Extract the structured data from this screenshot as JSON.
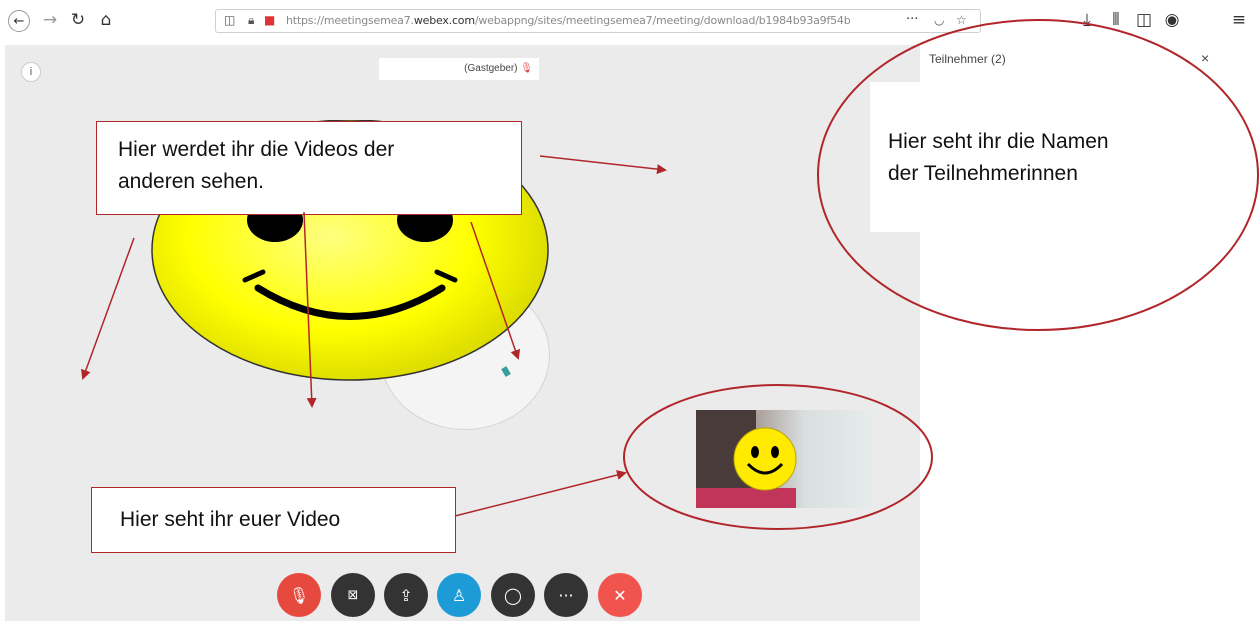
{
  "browser": {
    "url_prefix": "https://meetingsemea7.",
    "url_domain": "webex.com",
    "url_suffix": "/webappng/sites/meetingsemea7/meeting/download/b1984b93a9f54b",
    "menu_dots": "···"
  },
  "meeting": {
    "host_label": "(Gastgeber)",
    "info_label": "i"
  },
  "participants": {
    "title": "Teilnehmer (2)",
    "close": "×"
  },
  "controls": [
    {
      "name": "mute",
      "icon": "microphone-muted-icon",
      "color": "#e64a3f"
    },
    {
      "name": "video",
      "icon": "camera-off-icon",
      "color": "#333333"
    },
    {
      "name": "share",
      "icon": "share-icon",
      "color": "#333333"
    },
    {
      "name": "participants",
      "icon": "participants-icon",
      "color": "#1d9bd7"
    },
    {
      "name": "chat",
      "icon": "chat-icon",
      "color": "#333333"
    },
    {
      "name": "more",
      "icon": "more-icon",
      "color": "#333333"
    },
    {
      "name": "leave",
      "icon": "close-icon",
      "color": "#f0544c"
    }
  ],
  "annotations": {
    "videos_callout_line1": "Hier werdet ihr die Videos der",
    "videos_callout_line2": "anderen sehen.",
    "names_callout_line1": "Hier seht ihr die Namen",
    "names_callout_line2": "der Teilnehmerinnen",
    "own_video_callout": "Hier seht ihr euer Video",
    "annotation_color": "#b1262a"
  }
}
